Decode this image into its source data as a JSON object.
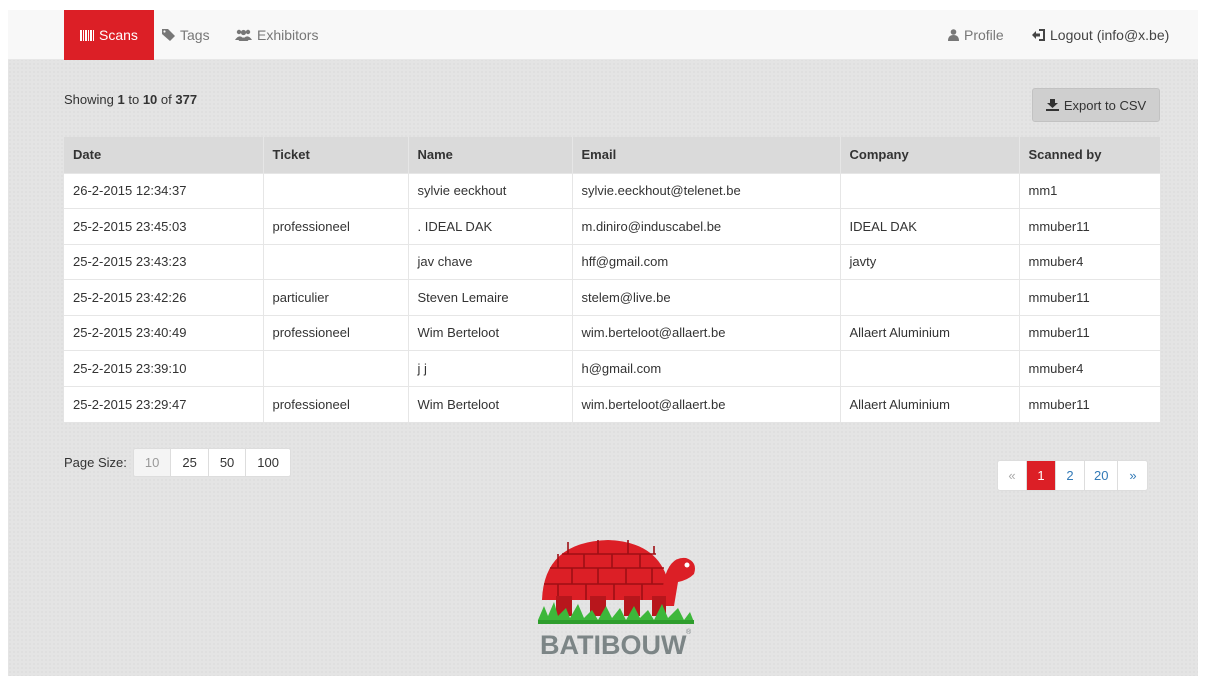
{
  "nav": {
    "scans": "Scans",
    "tags": "Tags",
    "exhibitors": "Exhibitors",
    "profile": "Profile",
    "logout": "Logout (info@x.be)"
  },
  "summary": {
    "prefix": "Showing",
    "from": "1",
    "to_word": "to",
    "to": "10",
    "of_word": "of",
    "total": "377"
  },
  "export_label": "Export to CSV",
  "table": {
    "headers": [
      "Date",
      "Ticket",
      "Name",
      "Email",
      "Company",
      "Scanned by"
    ],
    "rows": [
      [
        "26-2-2015 12:34:37",
        "",
        "sylvie eeckhout",
        "sylvie.eeckhout@telenet.be",
        "",
        "mm1"
      ],
      [
        "25-2-2015 23:45:03",
        "professioneel",
        ". IDEAL DAK",
        "m.diniro@induscabel.be",
        "IDEAL DAK",
        "mmuber11"
      ],
      [
        "25-2-2015 23:43:23",
        "",
        "jav chave",
        "hff@gmail.com",
        "javty",
        "mmuber4"
      ],
      [
        "25-2-2015 23:42:26",
        "particulier",
        "Steven Lemaire",
        "stelem@live.be",
        "",
        "mmuber11"
      ],
      [
        "25-2-2015 23:40:49",
        "professioneel",
        "Wim Berteloot",
        "wim.berteloot@allaert.be",
        "Allaert Aluminium",
        "mmuber11"
      ],
      [
        "25-2-2015 23:39:10",
        "",
        "j j",
        "h@gmail.com",
        "",
        "mmuber4"
      ],
      [
        "25-2-2015 23:29:47",
        "professioneel",
        "Wim Berteloot",
        "wim.berteloot@allaert.be",
        "Allaert Aluminium",
        "mmuber11"
      ]
    ]
  },
  "page_size": {
    "label": "Page Size:",
    "options": [
      "10",
      "25",
      "50",
      "100"
    ],
    "selected": "10"
  },
  "pagination": {
    "prev": "«",
    "pages": [
      "1",
      "2",
      "20"
    ],
    "next": "»",
    "current": "1"
  },
  "brand": {
    "name": "BATIBOUW",
    "mark": "®"
  },
  "colors": {
    "accent": "#dc1f26",
    "link": "#337ab7",
    "header_bg": "#dadada",
    "page_bg": "#e4e4e4"
  },
  "icons": {
    "scans": "barcode-icon",
    "tags": "tag-icon",
    "exhibitors": "users-icon",
    "profile": "user-icon",
    "logout": "logout-icon",
    "export": "download-icon"
  }
}
